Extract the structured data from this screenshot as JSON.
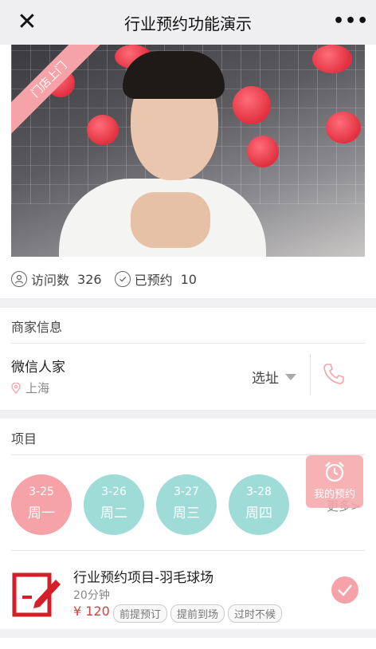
{
  "titlebar": {
    "title": "行业预约功能演示",
    "close_glyph": "✕",
    "more_glyph": "•••"
  },
  "hero": {
    "ribbon_label": "门店上门"
  },
  "stats": {
    "visits_label": "访问数",
    "visits_count": "326",
    "booked_label": "已预约",
    "booked_count": "10"
  },
  "merchant": {
    "section_title": "商家信息",
    "name": "微信人家",
    "city": "上海",
    "select_address_label": "选址",
    "icons": {
      "location": "location-pin-icon",
      "phone": "phone-icon"
    }
  },
  "project": {
    "section_title": "项目",
    "dates": [
      {
        "date": "3-25",
        "weekday": "周一",
        "selected": true
      },
      {
        "date": "3-26",
        "weekday": "周二",
        "selected": false
      },
      {
        "date": "3-27",
        "weekday": "周三",
        "selected": false
      },
      {
        "date": "3-28",
        "weekday": "周四",
        "selected": false
      }
    ],
    "more_label": "更多>",
    "item": {
      "name": "行业预约项目-羽毛球场",
      "duration": "20分钟",
      "price": "¥ 120",
      "tags": [
        "前提预订",
        "提前到场",
        "过时不候"
      ]
    }
  },
  "fab": {
    "label": "我的预约",
    "icon": "alarm-clock-icon"
  },
  "colors": {
    "accent_pink": "#f5a3a8",
    "teal": "#9fdcd8",
    "price_red": "#e4393c"
  }
}
